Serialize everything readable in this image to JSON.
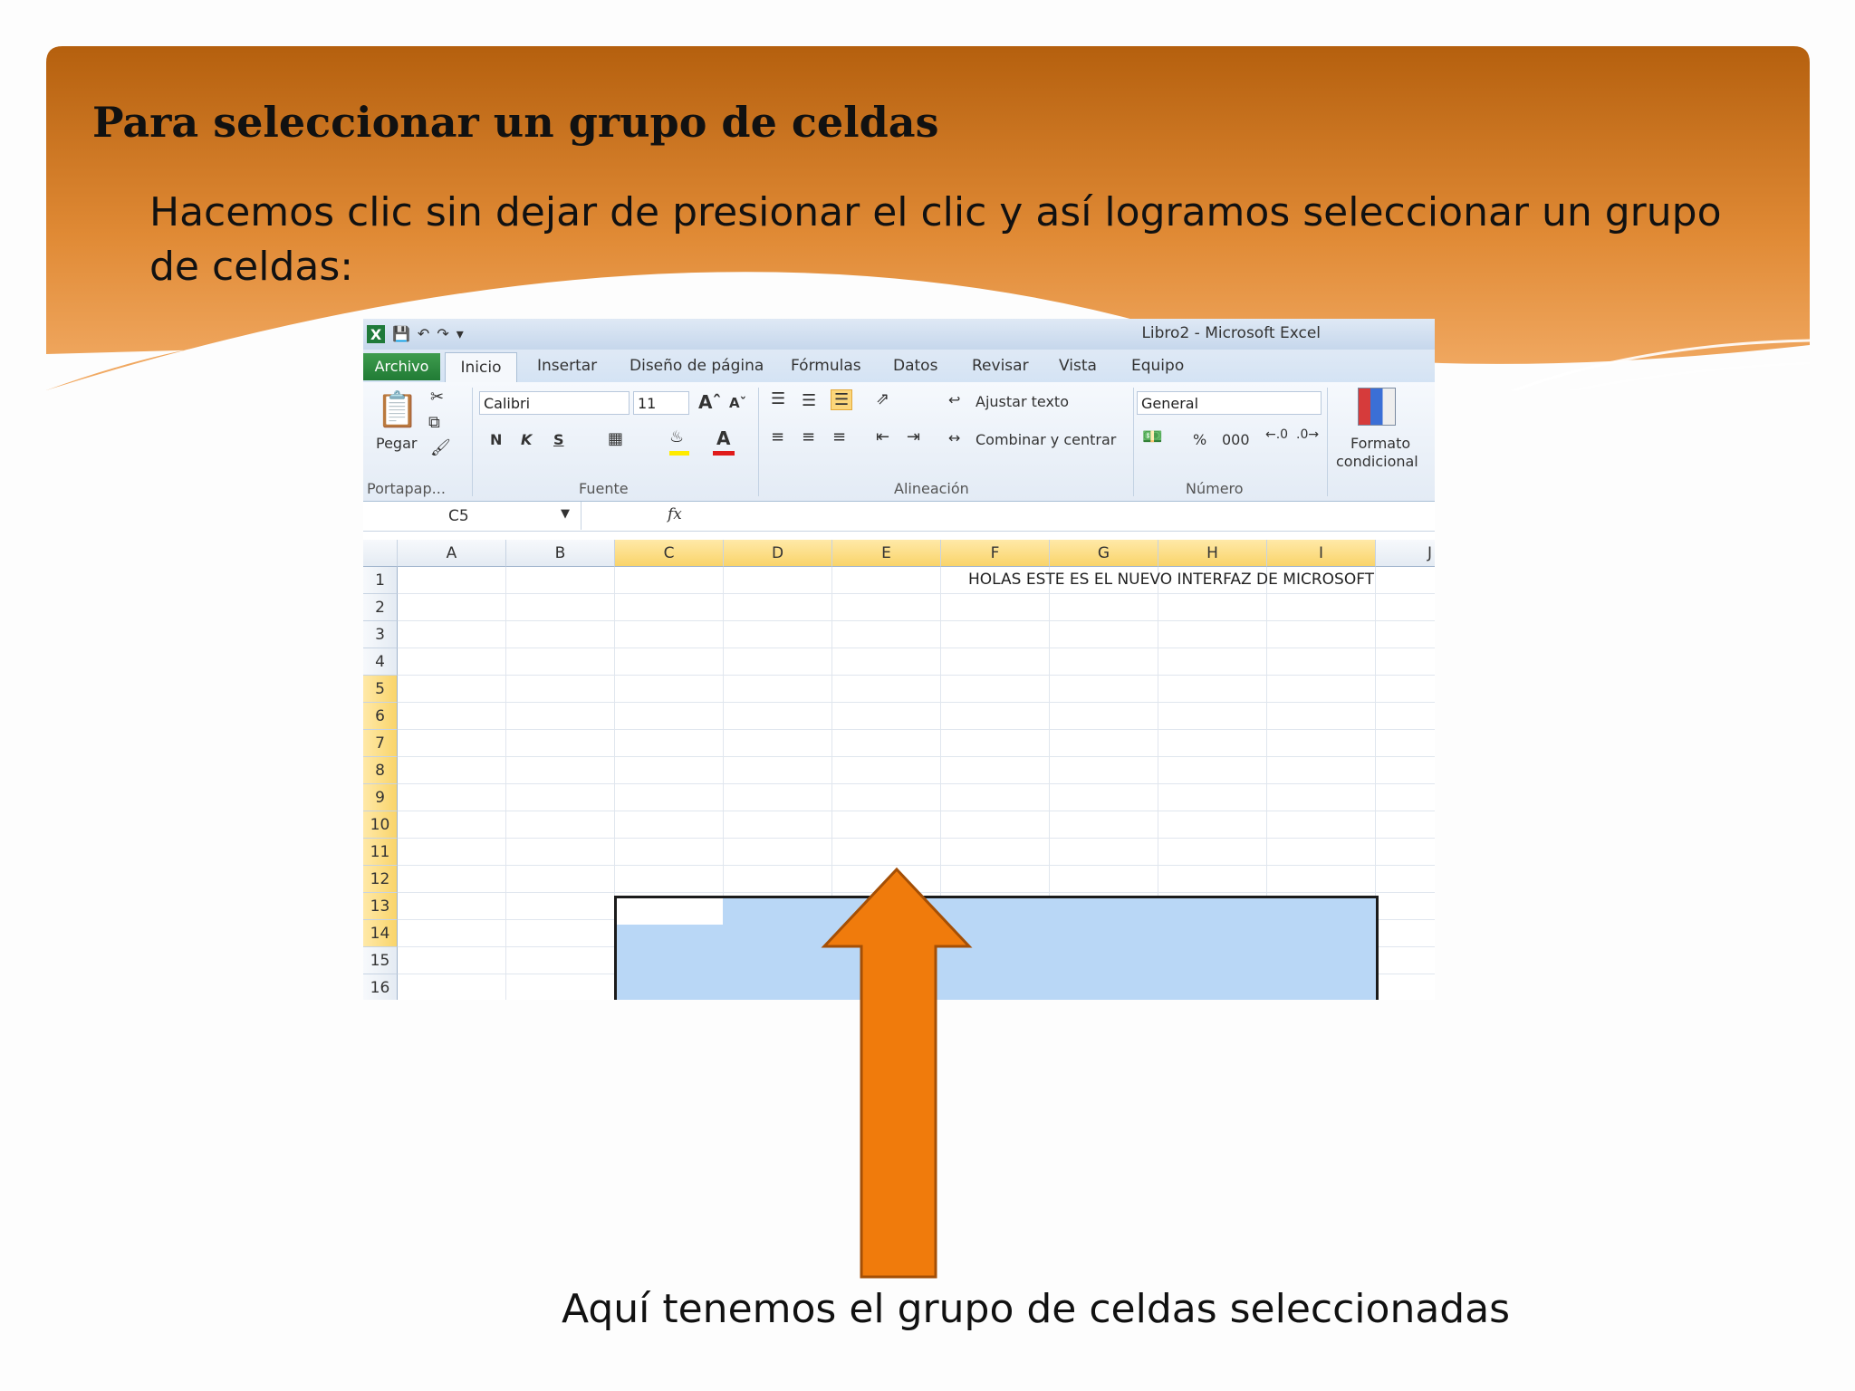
{
  "slide": {
    "title": "Para seleccionar un grupo de celdas",
    "body": "Hacemos clic sin dejar de presionar el clic  y así logramos seleccionar un grupo de celdas:",
    "caption": "Aquí tenemos el grupo de celdas seleccionadas",
    "colors": {
      "header_dark": "#b5600e",
      "header_light": "#f0a257",
      "arrow": "#f07b0c",
      "selection": "#b9d7f6"
    }
  },
  "excel": {
    "window_title": "Libro2  -  Microsoft Excel",
    "tabs": {
      "file": "Archivo",
      "home": "Inicio",
      "insert": "Insertar",
      "layout": "Diseño de página",
      "formulas": "Fórmulas",
      "data": "Datos",
      "review": "Revisar",
      "view": "Vista",
      "team": "Equipo"
    },
    "ribbon": {
      "paste": "Pegar",
      "font_name": "Calibri",
      "font_size": "11",
      "bold": "N",
      "italic": "K",
      "underline": "S",
      "wrap_text": "Ajustar texto",
      "merge_center": "Combinar y centrar",
      "number_format": "General",
      "percent": "%",
      "thousands": "000",
      "conditional_1": "Formato",
      "conditional_2": "condicional",
      "groups": {
        "clipboard": "Portapap...",
        "font": "Fuente",
        "alignment": "Alineación",
        "number": "Número"
      }
    },
    "name_box": "C5",
    "fx": "fx",
    "columns": [
      "A",
      "B",
      "C",
      "D",
      "E",
      "F",
      "G",
      "H",
      "I",
      "J"
    ],
    "rows": [
      "1",
      "2",
      "3",
      "4",
      "5",
      "6",
      "7",
      "8",
      "9",
      "10",
      "11",
      "12",
      "13",
      "14",
      "15",
      "16"
    ],
    "cell_F1": "HOLAS ESTE ES EL NUEVO INTERFAZ DE MICROSOFT",
    "selection_range": "C5:I14",
    "selected_columns": [
      "C",
      "D",
      "E",
      "F",
      "G",
      "H",
      "I"
    ],
    "selected_rows": [
      "5",
      "6",
      "7",
      "8",
      "9",
      "10",
      "11",
      "12",
      "13",
      "14"
    ]
  }
}
